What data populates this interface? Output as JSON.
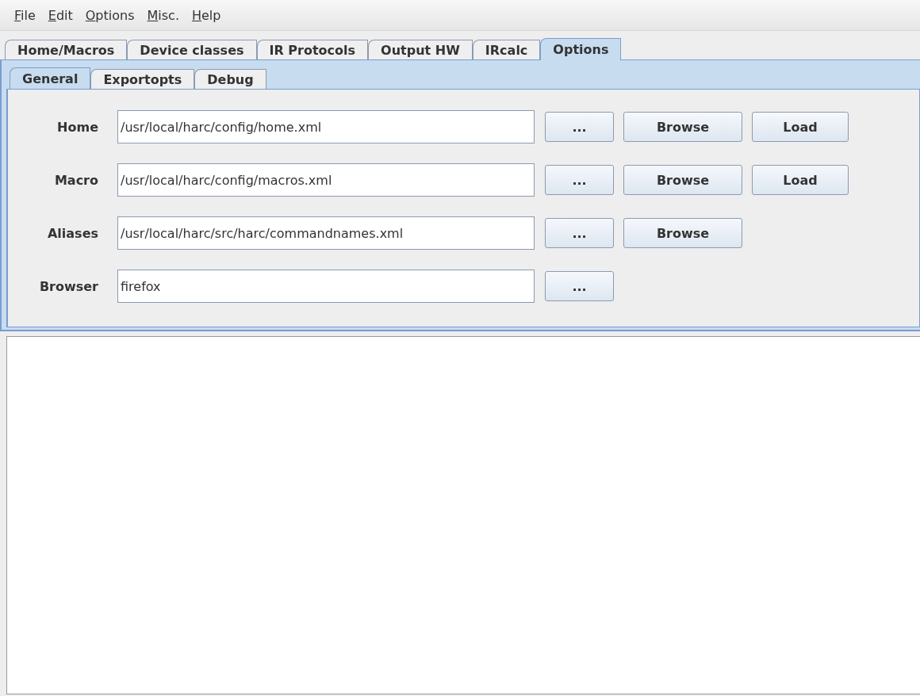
{
  "menu": [
    "File",
    "Edit",
    "Options",
    "Misc.",
    "Help"
  ],
  "tabs": [
    {
      "label": "Home/Macros",
      "selected": false
    },
    {
      "label": "Device classes",
      "selected": false
    },
    {
      "label": "IR Protocols",
      "selected": false
    },
    {
      "label": "Output HW",
      "selected": false
    },
    {
      "label": "IRcalc",
      "selected": false
    },
    {
      "label": "Options",
      "selected": true
    }
  ],
  "subtabs": [
    {
      "label": "General",
      "selected": true
    },
    {
      "label": "Exportopts",
      "selected": false
    },
    {
      "label": "Debug",
      "selected": false
    }
  ],
  "rows": [
    {
      "label": "Home",
      "value": "/usr/local/harc/config/home.xml",
      "buttons": [
        "...",
        "Browse",
        "Load"
      ]
    },
    {
      "label": "Macro",
      "value": "/usr/local/harc/config/macros.xml",
      "buttons": [
        "...",
        "Browse",
        "Load"
      ]
    },
    {
      "label": "Aliases",
      "value": "/usr/local/harc/src/harc/commandnames.xml",
      "buttons": [
        "...",
        "Browse"
      ]
    },
    {
      "label": "Browser",
      "value": "firefox",
      "buttons": [
        "..."
      ]
    }
  ]
}
